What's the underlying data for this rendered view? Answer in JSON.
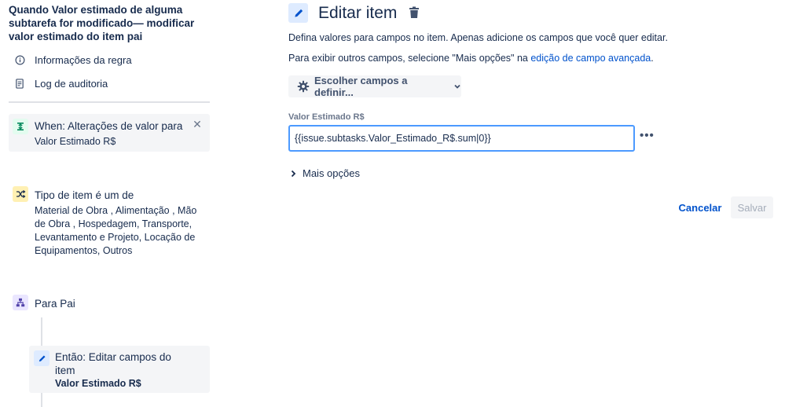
{
  "sidebar": {
    "rule_title": "Quando Valor estimado de alguma subtarefa for modificado— modificar valor estimado do item pai",
    "links": [
      {
        "label": "Informações da regra",
        "icon": "info-icon"
      },
      {
        "label": "Log de auditoria",
        "icon": "document-icon"
      }
    ],
    "trigger": {
      "title": "When: Alterações de valor para",
      "subtitle": "Valor Estimado R$",
      "icon": "trigger-icon",
      "color": "#e3fcef"
    },
    "condition": {
      "title": "Tipo de item é um de",
      "subtitle": "Material de Obra , Alimentação , Mão de Obra , Hospedagem, Transporte, Levantamento e Projeto, Locação de Equipamentos, Outros",
      "icon": "shuffle-icon",
      "color": "#fff0b3"
    },
    "branch": {
      "title": "Para Pai",
      "icon": "hierarchy-icon",
      "color": "#eae6ff"
    },
    "action": {
      "title": "Então: Editar campos do item",
      "subtitle": "Valor Estimado R$",
      "icon": "pencil-icon",
      "color": "#deebff"
    }
  },
  "main": {
    "title": "Editar item",
    "desc1": "Defina valores para campos no item. Apenas adicione os campos que você quer editar.",
    "desc2_prefix": "Para exibir outros campos, selecione \"Mais opções\" na ",
    "desc2_link": "edição de campo avançada",
    "desc2_suffix": ".",
    "choose_fields_label": "Escolher campos a definir...",
    "field_label": "Valor Estimado R$",
    "field_value": "{{issue.subtasks.Valor_Estimado_R$.sum|0}}",
    "more_dots": "•••",
    "more_options_label": "Mais opções",
    "cancel_label": "Cancelar",
    "save_label": "Salvar",
    "accent_color": "#0052cc"
  }
}
